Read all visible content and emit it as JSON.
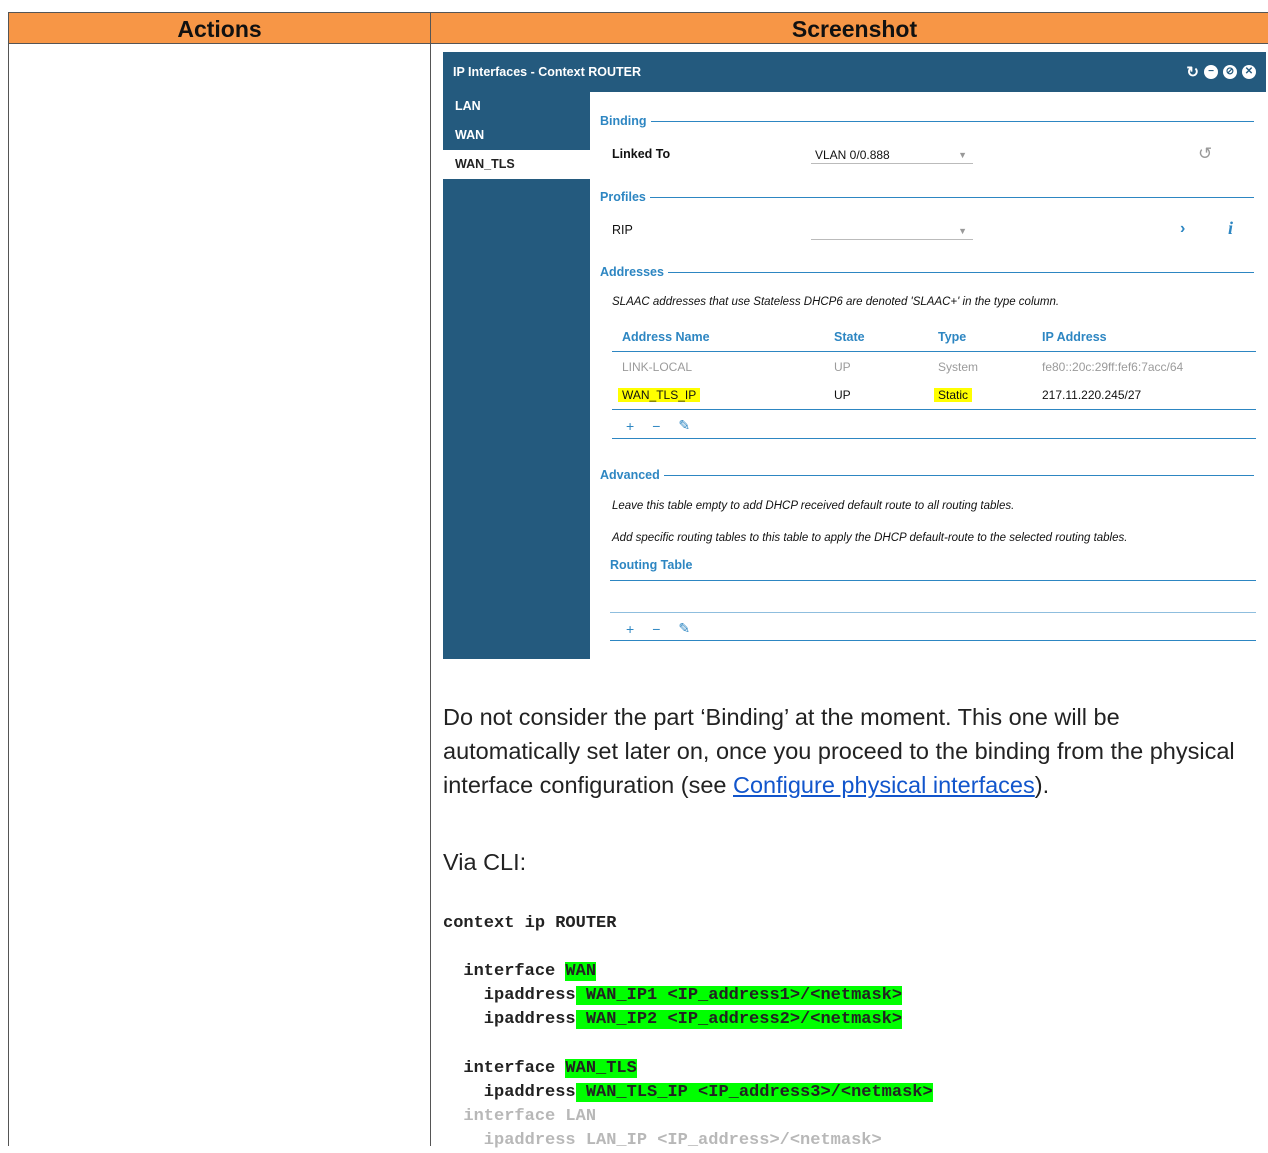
{
  "table": {
    "col_actions": "Actions",
    "col_screenshot": "Screenshot"
  },
  "window": {
    "title": "IP Interfaces - Context ROUTER",
    "sidebar": [
      "LAN",
      "WAN",
      "WAN_TLS"
    ],
    "binding": {
      "section": "Binding",
      "linked_to_label": "Linked To",
      "linked_to_value": "VLAN 0/0.888"
    },
    "profiles": {
      "section": "Profiles",
      "rip_label": "RIP",
      "rip_value": ""
    },
    "addresses": {
      "section": "Addresses",
      "note": "SLAAC addresses that use Stateless DHCP6 are denoted 'SLAAC+' in the type column.",
      "headers": [
        "Address Name",
        "State",
        "Type",
        "IP Address"
      ],
      "rows": [
        {
          "name": "LINK-LOCAL",
          "state": "UP",
          "type": "System",
          "ip": "fe80::20c:29ff:fef6:7acc/64"
        },
        {
          "name": "WAN_TLS_IP",
          "state": "UP",
          "type": "Static",
          "ip": "217.11.220.245/27"
        }
      ]
    },
    "advanced": {
      "section": "Advanced",
      "note1": "Leave this table empty to add DHCP received default route to all routing tables.",
      "note2": "Add specific routing tables to this table to apply the DHCP default-route to the selected routing tables.",
      "header": "Routing Table"
    }
  },
  "body": {
    "para1_a": "Do not consider the part ‘Binding’ at the moment. This one will be automatically set later on, once you proceed to the binding from the physical interface configuration (see ",
    "para1_link": "Configure physical interfaces",
    "para1_b": ").",
    "para2": "Via CLI:"
  },
  "cli": {
    "l1": "context ip ROUTER",
    "l2a": "  interface ",
    "l2b": "WAN",
    "l3a": "    ipaddress",
    "l3b": " WAN_IP1 <IP_address1>/<netmask>",
    "l4a": "    ipaddress",
    "l4b": " WAN_IP2 <IP_address2>/<netmask>",
    "l5a": "  interface ",
    "l5b": "WAN_TLS",
    "l6a": "    ipaddress",
    "l6b": " WAN_TLS_IP <IP_address3>/<netmask>",
    "l7": "  interface LAN",
    "l8": "    ipaddress LAN_IP <IP_address>/<netmask>"
  }
}
